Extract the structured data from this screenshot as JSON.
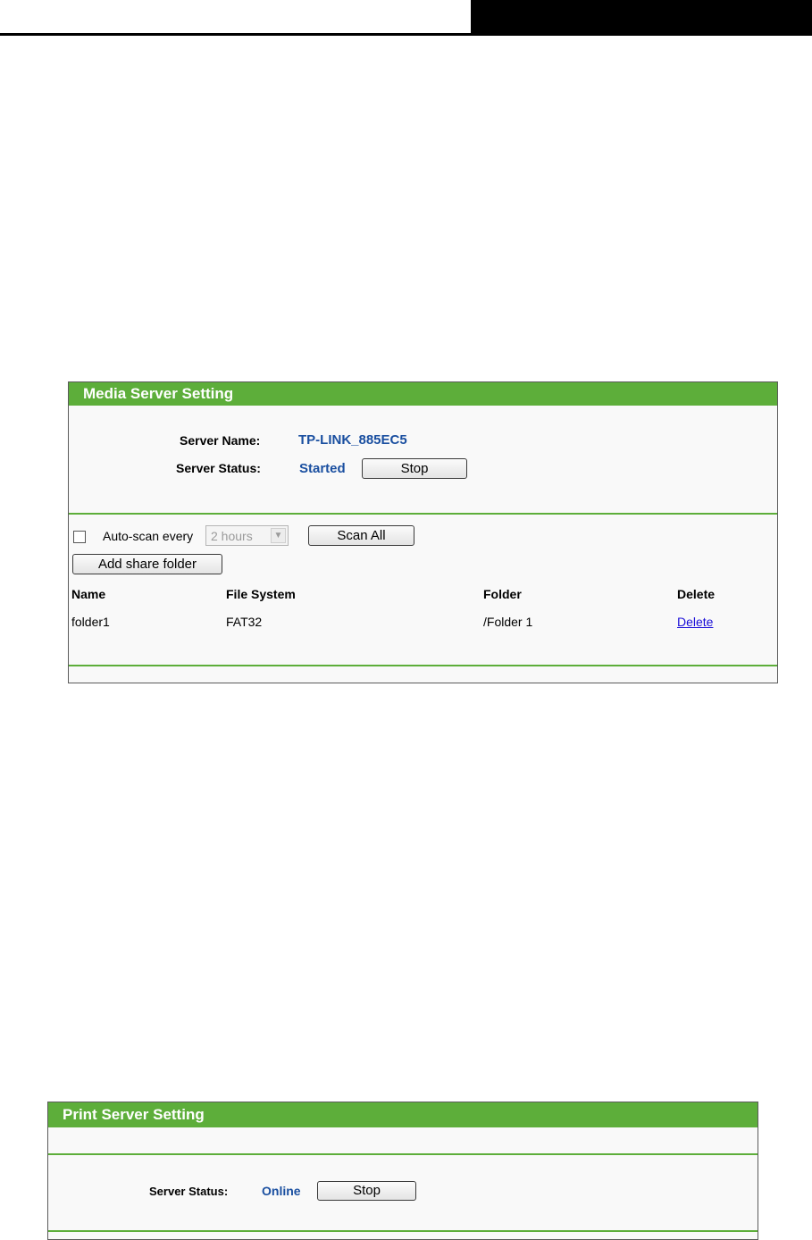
{
  "media_server": {
    "title": "Media Server Setting",
    "server_name_label": "Server Name:",
    "server_name_value": "TP-LINK_885EC5",
    "server_status_label": "Server Status:",
    "server_status_value": "Started",
    "stop_button": "Stop",
    "auto_scan_label": "Auto-scan every",
    "auto_scan_checked": false,
    "auto_scan_interval": "2 hours",
    "scan_all_button": "Scan All",
    "add_share_folder_button": "Add share folder",
    "table": {
      "headers": [
        "Name",
        "File System",
        "Folder",
        "Delete"
      ],
      "rows": [
        {
          "name": "folder1",
          "file_system": "FAT32",
          "folder": "/Folder 1",
          "delete": "Delete"
        }
      ]
    }
  },
  "print_server": {
    "title": "Print Server Setting",
    "server_status_label": "Server Status:",
    "server_status_value": "Online",
    "stop_button": "Stop"
  },
  "colors": {
    "header_green": "#5dae3a",
    "status_blue": "#1a4fa0",
    "link_blue": "#1a0ed8"
  }
}
